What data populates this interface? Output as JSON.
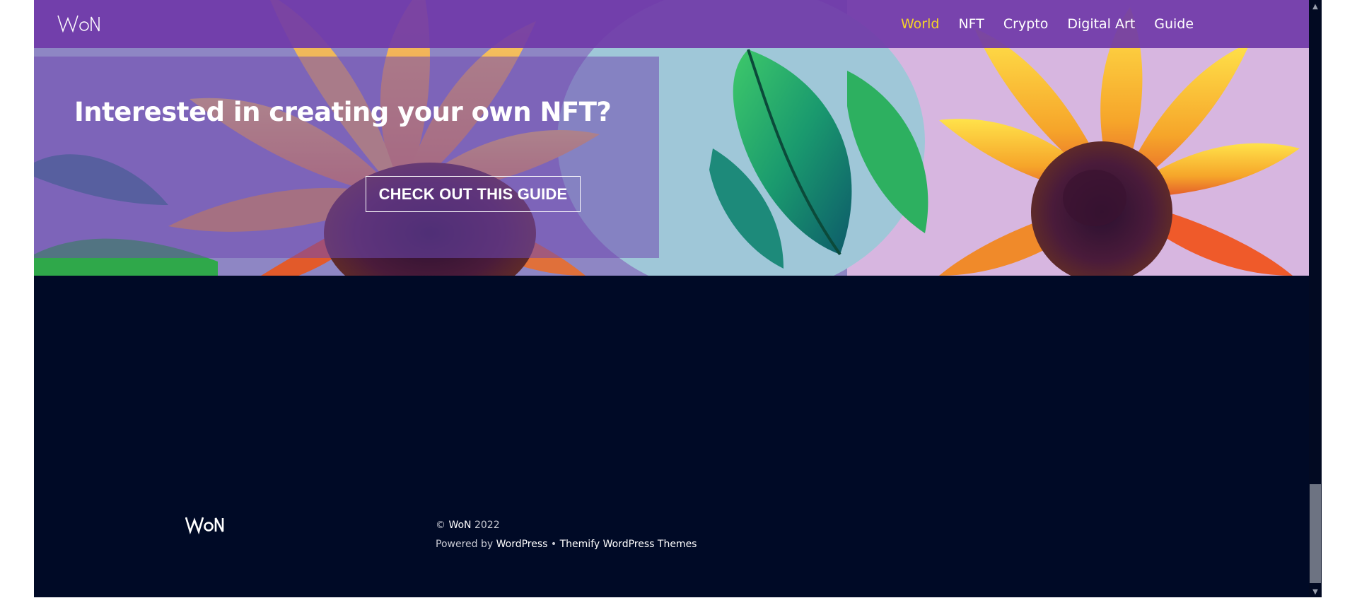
{
  "site": {
    "logo_text": "WoN"
  },
  "nav": {
    "items": [
      {
        "label": "World",
        "active": true
      },
      {
        "label": "NFT",
        "active": false
      },
      {
        "label": "Crypto",
        "active": false
      },
      {
        "label": "Digital Art",
        "active": false
      },
      {
        "label": "Guide",
        "active": false
      }
    ]
  },
  "hero": {
    "heading": "Interested in creating your own NFT?",
    "button_label": "CHECK OUT THIS GUIDE"
  },
  "footer": {
    "logo_text": "WoN",
    "copyright_symbol": "©",
    "copyright_name": "WoN",
    "copyright_year": "2022",
    "powered_by_prefix": "Powered by",
    "wordpress_link": "WordPress",
    "separator": "•",
    "themify_link": "Themify WordPress Themes"
  },
  "scrollbar": {
    "up_icon": "▲",
    "down_icon": "▼",
    "position_fraction": 0.97
  },
  "colors": {
    "nav_background": "#703aa8",
    "nav_active": "#f5d327",
    "footer_background": "#000a26",
    "panel_overlay": "#7048b0"
  }
}
